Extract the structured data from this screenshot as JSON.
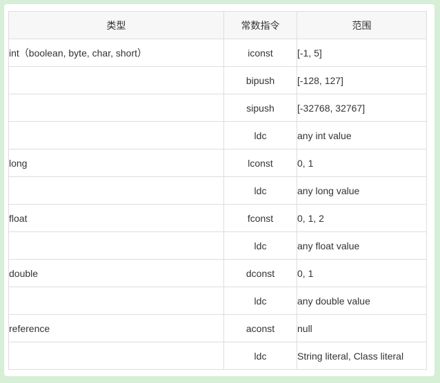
{
  "table": {
    "headers": [
      "类型",
      "常数指令",
      "范围"
    ],
    "rows": [
      {
        "type": "int（boolean, byte, char, short）",
        "instruction": "iconst",
        "range": "[-1, 5]"
      },
      {
        "type": "",
        "instruction": "bipush",
        "range": "[-128, 127]"
      },
      {
        "type": "",
        "instruction": "sipush",
        "range": "[-32768, 32767]"
      },
      {
        "type": "",
        "instruction": "ldc",
        "range": "any int value"
      },
      {
        "type": "long",
        "instruction": "lconst",
        "range": "0, 1"
      },
      {
        "type": "",
        "instruction": "ldc",
        "range": "any long value"
      },
      {
        "type": "float",
        "instruction": "fconst",
        "range": "0, 1, 2"
      },
      {
        "type": "",
        "instruction": "ldc",
        "range": "any float value"
      },
      {
        "type": "double",
        "instruction": "dconst",
        "range": "0, 1"
      },
      {
        "type": "",
        "instruction": "ldc",
        "range": "any double value"
      },
      {
        "type": "reference",
        "instruction": "aconst",
        "range": "null"
      },
      {
        "type": "",
        "instruction": "ldc",
        "range": "String literal, Class literal"
      }
    ]
  },
  "colors": {
    "page_background": "#d6efd6",
    "panel_background": "#ffffff",
    "header_background": "#f7f7f7",
    "border": "#dddddd",
    "text": "#333333"
  }
}
